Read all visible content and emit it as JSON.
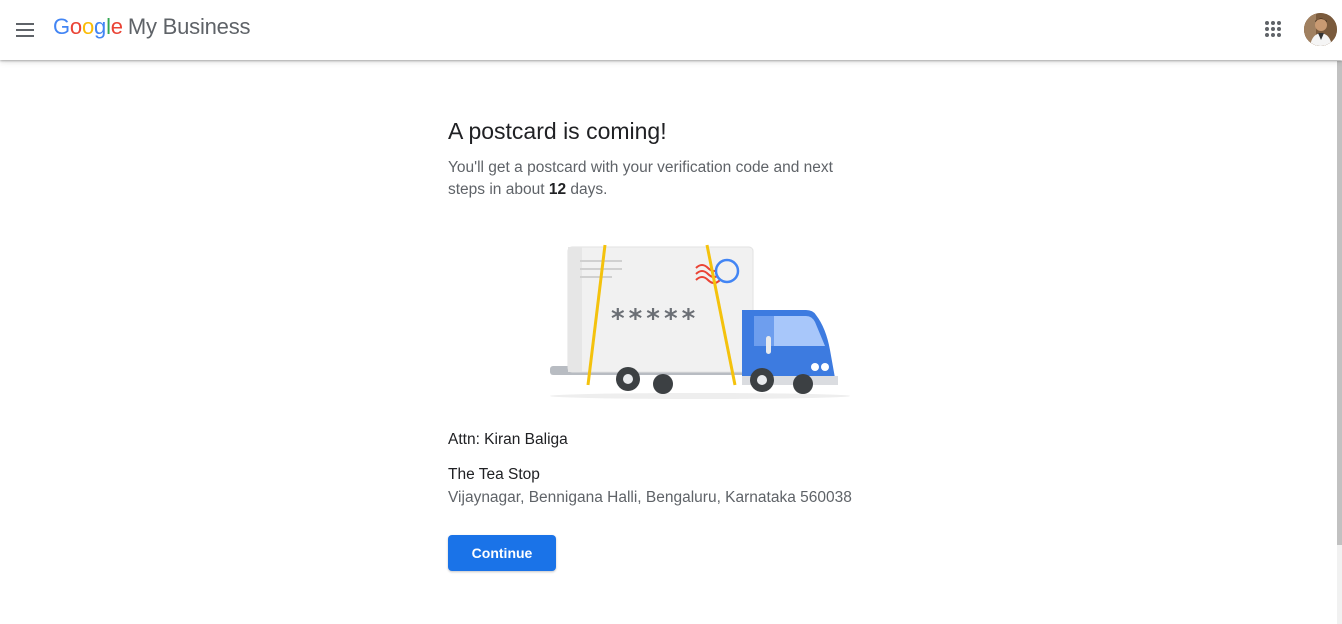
{
  "header": {
    "brand_letters": [
      "G",
      "o",
      "o",
      "g",
      "l",
      "e"
    ],
    "product_name": "My Business",
    "menu_icon": "hamburger-menu-icon",
    "apps_icon": "apps-grid-icon",
    "avatar_icon": "user-avatar"
  },
  "main": {
    "title": "A postcard is coming!",
    "subtitle_before": "You'll get a postcard with your verification code and next steps in about ",
    "subtitle_days": "12",
    "subtitle_after": " days.",
    "code_mask": "*****",
    "attn": "Attn: Kiran Baliga",
    "business_name": "The Tea Stop",
    "business_address": "Vijaynagar, Bennigana Halli, Bengaluru, Karnataka 560038",
    "continue_label": "Continue"
  },
  "colors": {
    "primary": "#1a73e8",
    "text_primary": "#202124",
    "text_secondary": "#5f6368",
    "google_blue": "#4285F4",
    "google_red": "#EA4335",
    "google_yellow": "#FBBC05",
    "google_green": "#34A853",
    "truck_blue": "#3d7be0",
    "strap_yellow": "#f4c20d"
  }
}
